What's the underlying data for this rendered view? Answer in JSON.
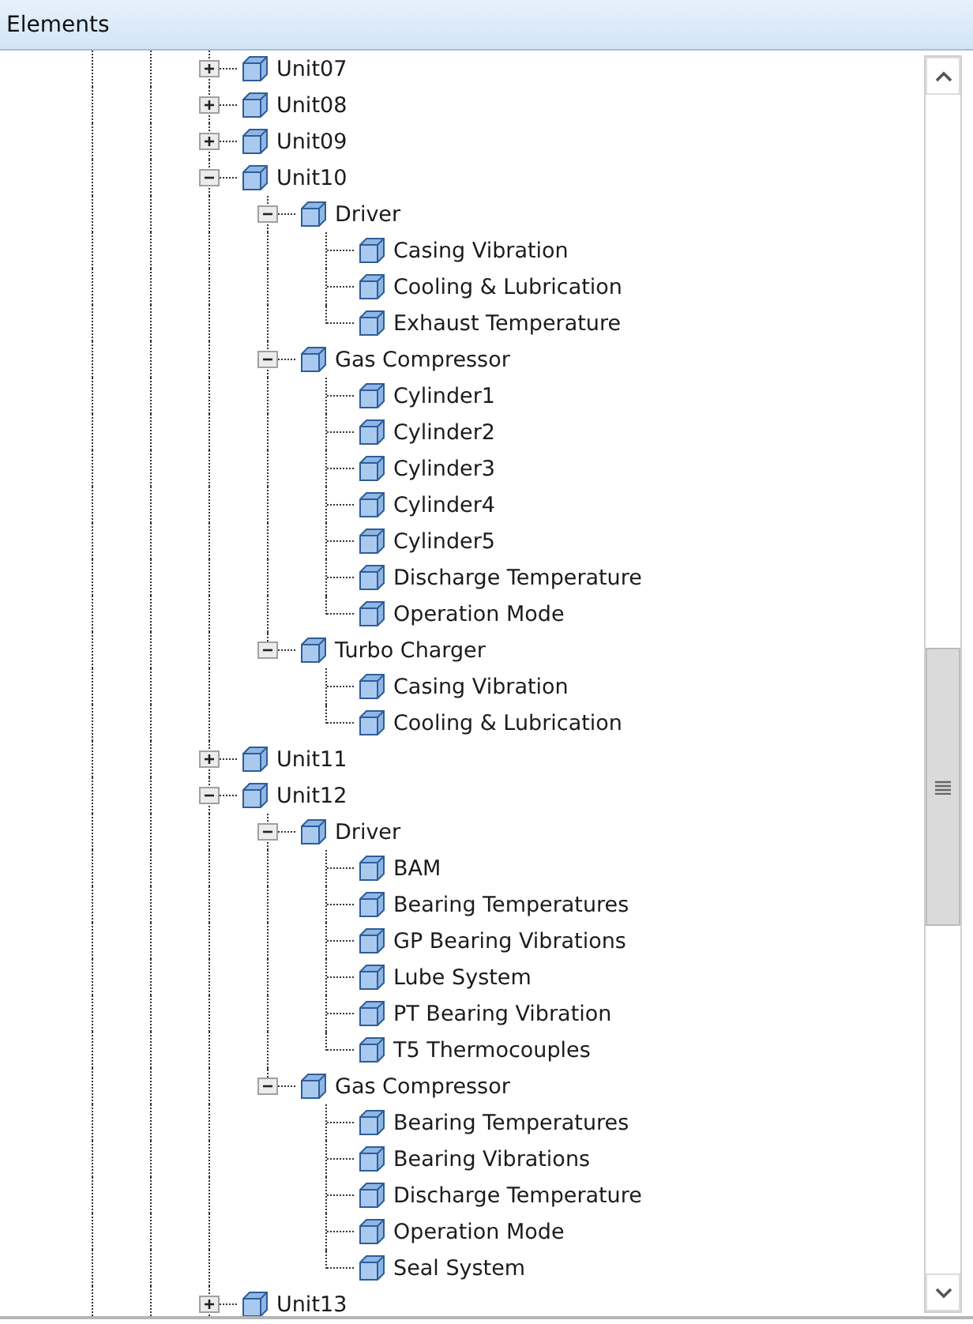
{
  "panel": {
    "title": "Elements"
  },
  "tree": [
    {
      "label": "Unit07",
      "expanded": false
    },
    {
      "label": "Unit08",
      "expanded": false
    },
    {
      "label": "Unit09",
      "expanded": false
    },
    {
      "label": "Unit10",
      "expanded": true,
      "children": [
        {
          "label": "Driver",
          "expanded": true,
          "children": [
            {
              "label": "Casing Vibration"
            },
            {
              "label": "Cooling & Lubrication"
            },
            {
              "label": "Exhaust Temperature"
            }
          ]
        },
        {
          "label": "Gas Compressor",
          "expanded": true,
          "children": [
            {
              "label": "Cylinder1"
            },
            {
              "label": "Cylinder2"
            },
            {
              "label": "Cylinder3"
            },
            {
              "label": "Cylinder4"
            },
            {
              "label": "Cylinder5"
            },
            {
              "label": "Discharge Temperature"
            },
            {
              "label": "Operation Mode"
            }
          ]
        },
        {
          "label": "Turbo Charger",
          "expanded": true,
          "children": [
            {
              "label": "Casing Vibration"
            },
            {
              "label": "Cooling & Lubrication"
            }
          ]
        }
      ]
    },
    {
      "label": "Unit11",
      "expanded": false
    },
    {
      "label": "Unit12",
      "expanded": true,
      "children": [
        {
          "label": "Driver",
          "expanded": true,
          "children": [
            {
              "label": "BAM"
            },
            {
              "label": "Bearing Temperatures"
            },
            {
              "label": "GP Bearing Vibrations"
            },
            {
              "label": "Lube System"
            },
            {
              "label": "PT Bearing Vibration"
            },
            {
              "label": "T5 Thermocouples"
            }
          ]
        },
        {
          "label": "Gas Compressor",
          "expanded": true,
          "children": [
            {
              "label": "Bearing Temperatures"
            },
            {
              "label": "Bearing Vibrations"
            },
            {
              "label": "Discharge Temperature"
            },
            {
              "label": "Operation Mode"
            },
            {
              "label": "Seal System"
            }
          ]
        }
      ]
    },
    {
      "label": "Unit13",
      "expanded": false
    }
  ]
}
